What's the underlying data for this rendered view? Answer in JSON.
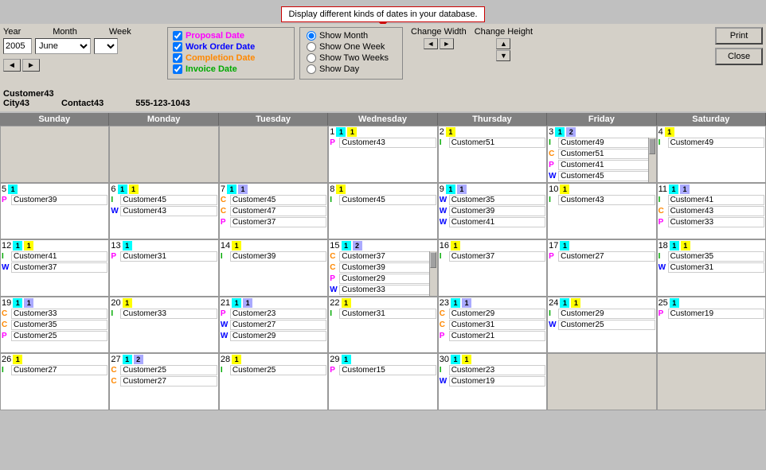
{
  "tooltip": {
    "text": "Display different kinds of dates in your database."
  },
  "toolbar": {
    "year_label": "Year",
    "month_label": "Month",
    "week_label": "Week",
    "year_value": "2005",
    "month_value": "June",
    "week_value": ""
  },
  "legend": {
    "proposal_label": "Proposal Date",
    "workorder_label": "Work Order Date",
    "completion_label": "Completion Date",
    "invoice_label": "Invoice Date"
  },
  "radio": {
    "show_month": "Show Month",
    "show_one_week": "Show One Week",
    "show_two_weeks": "Show Two Weeks",
    "show_day": "Show Day"
  },
  "size": {
    "change_width": "Change Width",
    "change_height": "Change Height"
  },
  "buttons": {
    "print": "Print",
    "close": "Close"
  },
  "customer": {
    "name": "Customer43",
    "city": "City43",
    "contact": "Contact43",
    "phone": "555-123-1043"
  },
  "calendar": {
    "headers": [
      "Sunday",
      "Monday",
      "Tuesday",
      "Wednesday",
      "Thursday",
      "Friday",
      "Saturday"
    ],
    "rows": [
      [
        {
          "date": "",
          "entries": [],
          "empty": true
        },
        {
          "date": "",
          "entries": [],
          "empty": true
        },
        {
          "date": "",
          "entries": [],
          "empty": true
        },
        {
          "date": "1",
          "badges": [
            "cyan",
            "yellow"
          ],
          "entries": [
            {
              "type": "P",
              "name": "Customer43"
            }
          ],
          "scrollable": false
        },
        {
          "date": "2",
          "badges": [
            "yellow"
          ],
          "entries": [
            {
              "type": "I",
              "name": "Customer51"
            }
          ],
          "scrollable": false
        },
        {
          "date": "3",
          "badges": [
            "cyan",
            "blue",
            "blue"
          ],
          "entries": [
            {
              "type": "I",
              "name": "Customer49"
            },
            {
              "type": "C",
              "name": "Customer51"
            },
            {
              "type": "P",
              "name": "Customer41"
            },
            {
              "type": "W",
              "name": "Customer45"
            }
          ],
          "scrollable": true
        },
        {
          "date": "4",
          "badges": [
            "yellow"
          ],
          "entries": [
            {
              "type": "I",
              "name": "Customer49"
            }
          ],
          "scrollable": false
        }
      ],
      [
        {
          "date": "5",
          "badges": [
            "cyan"
          ],
          "entries": [
            {
              "type": "P",
              "name": "Customer39"
            }
          ],
          "scrollable": false
        },
        {
          "date": "6",
          "badges": [
            "cyan",
            "yellow"
          ],
          "entries": [
            {
              "type": "I",
              "name": "Customer45"
            },
            {
              "type": "W",
              "name": "Customer43"
            }
          ],
          "scrollable": false
        },
        {
          "date": "7",
          "badges": [
            "cyan",
            "blue"
          ],
          "entries": [
            {
              "type": "C",
              "name": "Customer45"
            },
            {
              "type": "C",
              "name": "Customer47"
            },
            {
              "type": "P",
              "name": "Customer37"
            }
          ],
          "scrollable": false
        },
        {
          "date": "8",
          "badges": [
            "yellow"
          ],
          "entries": [
            {
              "type": "I",
              "name": "Customer45"
            }
          ],
          "scrollable": false
        },
        {
          "date": "9",
          "badges": [
            "cyan",
            "blue"
          ],
          "entries": [
            {
              "type": "W",
              "name": "Customer35"
            },
            {
              "type": "W",
              "name": "Customer39"
            },
            {
              "type": "W",
              "name": "Customer41"
            }
          ],
          "scrollable": false
        },
        {
          "date": "10",
          "badges": [
            "yellow"
          ],
          "entries": [
            {
              "type": "I",
              "name": "Customer43"
            }
          ],
          "scrollable": false
        },
        {
          "date": "11",
          "badges": [
            "cyan",
            "blue"
          ],
          "entries": [
            {
              "type": "I",
              "name": "Customer41"
            },
            {
              "type": "C",
              "name": "Customer43"
            },
            {
              "type": "P",
              "name": "Customer33"
            }
          ],
          "scrollable": false
        }
      ],
      [
        {
          "date": "12",
          "badges": [
            "cyan",
            "yellow"
          ],
          "entries": [
            {
              "type": "I",
              "name": "Customer41"
            },
            {
              "type": "W",
              "name": "Customer37"
            }
          ],
          "scrollable": false
        },
        {
          "date": "13",
          "badges": [
            "cyan"
          ],
          "entries": [
            {
              "type": "P",
              "name": "Customer31"
            }
          ],
          "scrollable": false
        },
        {
          "date": "14",
          "badges": [
            "yellow"
          ],
          "entries": [
            {
              "type": "I",
              "name": "Customer39"
            }
          ],
          "scrollable": false
        },
        {
          "date": "15",
          "badges": [
            "cyan",
            "blue",
            "blue"
          ],
          "entries": [
            {
              "type": "C",
              "name": "Customer37"
            },
            {
              "type": "C",
              "name": "Customer39"
            },
            {
              "type": "P",
              "name": "Customer29"
            },
            {
              "type": "W",
              "name": "Customer33"
            }
          ],
          "scrollable": true
        },
        {
          "date": "16",
          "badges": [
            "yellow"
          ],
          "entries": [
            {
              "type": "I",
              "name": "Customer37"
            }
          ],
          "scrollable": false
        },
        {
          "date": "17",
          "badges": [
            "cyan"
          ],
          "entries": [
            {
              "type": "P",
              "name": "Customer27"
            }
          ],
          "scrollable": false
        },
        {
          "date": "18",
          "badges": [
            "cyan",
            "yellow"
          ],
          "entries": [
            {
              "type": "I",
              "name": "Customer35"
            },
            {
              "type": "W",
              "name": "Customer31"
            }
          ],
          "scrollable": false
        }
      ],
      [
        {
          "date": "19",
          "badges": [
            "cyan",
            "blue"
          ],
          "entries": [
            {
              "type": "C",
              "name": "Customer33"
            },
            {
              "type": "C",
              "name": "Customer35"
            },
            {
              "type": "P",
              "name": "Customer25"
            }
          ],
          "scrollable": false
        },
        {
          "date": "20",
          "badges": [
            "yellow"
          ],
          "entries": [
            {
              "type": "I",
              "name": "Customer33"
            }
          ],
          "scrollable": false
        },
        {
          "date": "21",
          "badges": [
            "cyan",
            "blue"
          ],
          "entries": [
            {
              "type": "P",
              "name": "Customer23"
            },
            {
              "type": "W",
              "name": "Customer27"
            },
            {
              "type": "W",
              "name": "Customer29"
            }
          ],
          "scrollable": false
        },
        {
          "date": "22",
          "badges": [
            "yellow"
          ],
          "entries": [
            {
              "type": "I",
              "name": "Customer31"
            }
          ],
          "scrollable": false
        },
        {
          "date": "23",
          "badges": [
            "cyan",
            "blue"
          ],
          "entries": [
            {
              "type": "C",
              "name": "Customer29"
            },
            {
              "type": "C",
              "name": "Customer31"
            },
            {
              "type": "P",
              "name": "Customer21"
            }
          ],
          "scrollable": false
        },
        {
          "date": "24",
          "badges": [
            "cyan",
            "yellow"
          ],
          "entries": [
            {
              "type": "I",
              "name": "Customer29"
            },
            {
              "type": "W",
              "name": "Customer25"
            }
          ],
          "scrollable": false
        },
        {
          "date": "25",
          "badges": [
            "cyan"
          ],
          "entries": [
            {
              "type": "P",
              "name": "Customer19"
            }
          ],
          "scrollable": false
        }
      ],
      [
        {
          "date": "26",
          "badges": [
            "yellow"
          ],
          "entries": [
            {
              "type": "I",
              "name": "Customer27"
            }
          ],
          "scrollable": false
        },
        {
          "date": "27",
          "badges": [
            "cyan",
            "blue",
            "blue"
          ],
          "entries": [
            {
              "type": "C",
              "name": "Customer25"
            },
            {
              "type": "C",
              "name": "Customer27"
            }
          ],
          "scrollable": false
        },
        {
          "date": "28",
          "badges": [
            "yellow"
          ],
          "entries": [
            {
              "type": "I",
              "name": "Customer25"
            }
          ],
          "scrollable": false
        },
        {
          "date": "29",
          "badges": [
            "cyan"
          ],
          "entries": [
            {
              "type": "P",
              "name": "Customer15"
            }
          ],
          "scrollable": false
        },
        {
          "date": "30",
          "badges": [
            "cyan",
            "yellow"
          ],
          "entries": [
            {
              "type": "I",
              "name": "Customer23"
            },
            {
              "type": "W",
              "name": "Customer19"
            }
          ],
          "scrollable": false
        },
        {
          "date": "",
          "entries": [],
          "empty": true
        },
        {
          "date": "",
          "entries": [],
          "empty": true
        }
      ]
    ]
  }
}
